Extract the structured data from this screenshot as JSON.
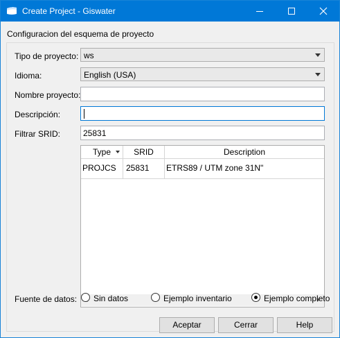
{
  "window": {
    "title": "Create Project - Giswater"
  },
  "group": {
    "title": "Configuracion del esquema de proyecto"
  },
  "form": {
    "tipo_label": "Tipo de proyecto:",
    "tipo_value": "ws",
    "idioma_label": "Idioma:",
    "idioma_value": "English (USA)",
    "nombre_label": "Nombre proyecto:",
    "nombre_value": "",
    "descripcion_label": "Descripción:",
    "descripcion_value": "",
    "srid_label": "Filtrar SRID:",
    "srid_value": "25831"
  },
  "table": {
    "headers": [
      "Type",
      "SRID",
      "Description"
    ],
    "rows": [
      [
        "PROJCS",
        "25831",
        "ETRS89 / UTM zone 31N\""
      ]
    ]
  },
  "datasource": {
    "label": "Fuente de datos:",
    "options": [
      "Sin datos",
      "Ejemplo inventario",
      "Ejemplo completo"
    ],
    "selected": "Ejemplo completo"
  },
  "buttons": {
    "accept": "Aceptar",
    "close": "Cerrar",
    "help": "Help"
  }
}
